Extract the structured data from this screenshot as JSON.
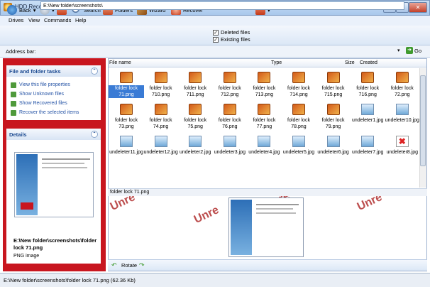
{
  "window": {
    "title": "HDD Recovery Pro 3.7 [Evaluation version]"
  },
  "menu": [
    "Drives",
    "View",
    "Commands",
    "Help"
  ],
  "toolbar": {
    "back": "Back",
    "search": "Search",
    "folders": "Folders",
    "wizard": "Wizard",
    "recover": "Recover",
    "deleted_files": "Deleted files",
    "existing_files": "Existing files"
  },
  "address": {
    "label": "Address bar:",
    "value": "E:\\New folder\\screenshots\\",
    "go": "Go"
  },
  "tasks": {
    "title": "File and folder tasks",
    "items": [
      "View this file properties",
      "Show Unknown files",
      "Show Recovered files",
      "Recover the selected items"
    ]
  },
  "details": {
    "title": "Details",
    "path": "E:\\New folder\\screenshots\\folder lock 71.png",
    "type": "PNG image"
  },
  "columns": [
    "File name",
    "Type",
    "Size",
    "Created"
  ],
  "files": [
    {
      "name": "folder lock 71.png",
      "kind": "lock",
      "selected": true
    },
    {
      "name": "folder lock 710.png",
      "kind": "lock"
    },
    {
      "name": "folder lock 711.png",
      "kind": "lock"
    },
    {
      "name": "folder lock 712.png",
      "kind": "lock"
    },
    {
      "name": "folder lock 713.png",
      "kind": "lock"
    },
    {
      "name": "folder lock 714.png",
      "kind": "lock"
    },
    {
      "name": "folder lock 715.png",
      "kind": "lock"
    },
    {
      "name": "folder lock 716.png",
      "kind": "lock"
    },
    {
      "name": "folder lock 72.png",
      "kind": "lock"
    },
    {
      "name": "folder lock 73.png",
      "kind": "lock"
    },
    {
      "name": "folder lock 74.png",
      "kind": "lock"
    },
    {
      "name": "folder lock 75.png",
      "kind": "lock"
    },
    {
      "name": "folder lock 76.png",
      "kind": "lock"
    },
    {
      "name": "folder lock 77.png",
      "kind": "lock"
    },
    {
      "name": "folder lock 78.png",
      "kind": "lock"
    },
    {
      "name": "folder lock 79.png",
      "kind": "lock"
    },
    {
      "name": "undeleter1.jpg",
      "kind": "jpg"
    },
    {
      "name": "undeleter10.jpg",
      "kind": "jpg"
    },
    {
      "name": "undeleter11.jpg",
      "kind": "jpg"
    },
    {
      "name": "undeleter12.jpg",
      "kind": "jpg"
    },
    {
      "name": "undeleter2.jpg",
      "kind": "jpg"
    },
    {
      "name": "undeleter3.jpg",
      "kind": "jpg"
    },
    {
      "name": "undeleter4.jpg",
      "kind": "jpg"
    },
    {
      "name": "undeleter5.jpg",
      "kind": "jpg"
    },
    {
      "name": "undeleter6.jpg",
      "kind": "jpg"
    },
    {
      "name": "undeleter7.jpg",
      "kind": "jpg"
    },
    {
      "name": "undeleter8.jpg",
      "kind": "bad"
    }
  ],
  "preview": {
    "filename": "folder lock 71.png",
    "watermark": "Unre",
    "rotate": "Rotate"
  },
  "status": {
    "text": "E:\\New folder\\screenshots\\folder lock 71.png (62.36 Kb)"
  }
}
